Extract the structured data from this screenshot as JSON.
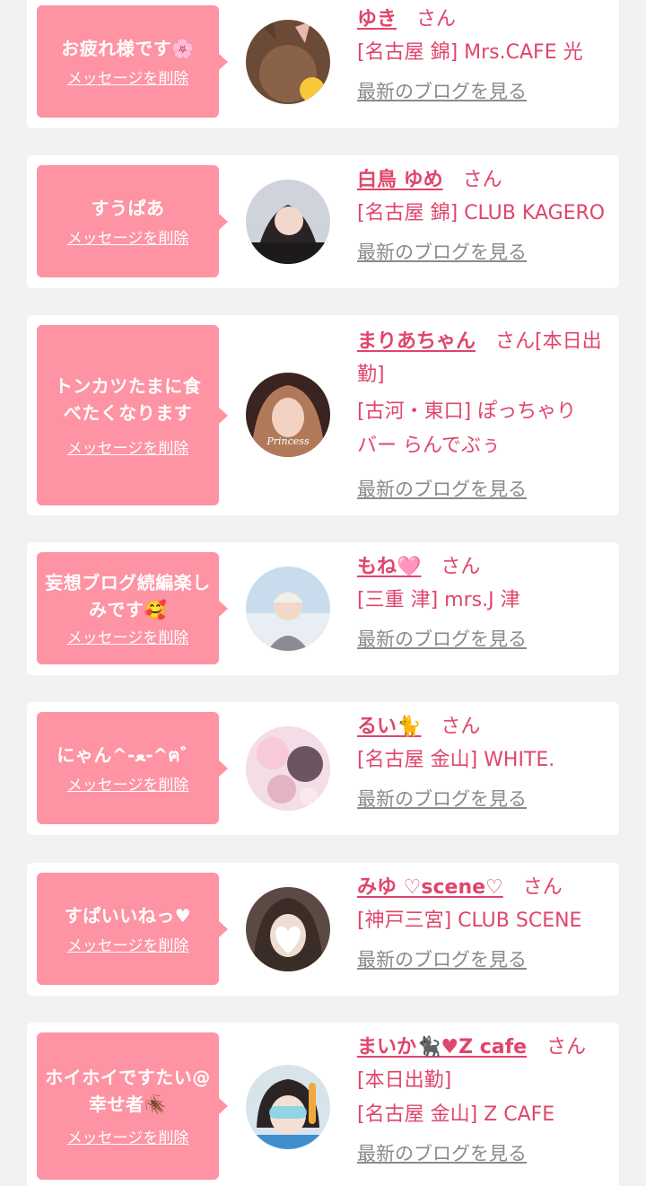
{
  "delete_label": "メッセージを削除",
  "blog_label": "最新のブログを見る",
  "san_label": "さん",
  "colors": {
    "bubble": "#fe93a3",
    "accent": "#e0456b",
    "link_gray": "#8a8a8a",
    "background": "#f2f2f2"
  },
  "entries": [
    {
      "message": "お疲れ様です🌸",
      "name": "ゆき",
      "suffix": "さん",
      "shop_lines": [
        "[名古屋 錦] Mrs.CAFE 光"
      ]
    },
    {
      "message": "すうぱあ",
      "name": "白鳥 ゆめ",
      "suffix": "さん",
      "shop_lines": [
        "[名古屋 錦] CLUB KAGERO"
      ]
    },
    {
      "message": "トンカツたまに食べたくなります",
      "name": "まりあちゃん",
      "suffix": "さん[本日出勤]",
      "shop_lines": [
        "[古河・東口] ぽっちゃり",
        "バー らんでぶぅ"
      ]
    },
    {
      "message": "妄想ブログ続編楽しみです🥰",
      "name": "もね🩷",
      "suffix": "さん",
      "shop_lines": [
        "[三重 津] mrs.J 津"
      ]
    },
    {
      "message": "にゃん^-ﻌ-^ฅ゛",
      "name": "るい🐈",
      "suffix": "さん",
      "shop_lines": [
        "[名古屋 金山] WHITE."
      ]
    },
    {
      "message": "すぱいいねっ♥",
      "name": "みゆ ♡scene♡",
      "suffix": "さん",
      "shop_lines": [
        "[神戸三宮] CLUB SCENE"
      ]
    },
    {
      "message": "ホイホイですたい@幸せ者🪳",
      "name": "まいか🐈‍⬛♥Z cafe",
      "suffix": "さん",
      "shop_lines": [
        "[本日出勤]",
        "[名古屋 金山] Z CAFE"
      ]
    }
  ]
}
